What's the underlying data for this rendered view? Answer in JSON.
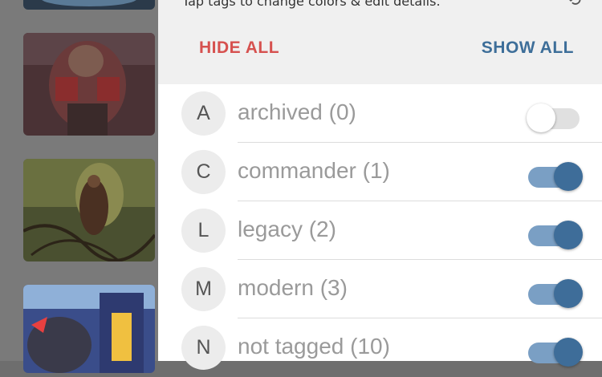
{
  "header": {
    "hint": "Tap tags to change colors & edit details.",
    "hide_all_label": "HIDE ALL",
    "show_all_label": "SHOW ALL"
  },
  "tags": [
    {
      "letter": "A",
      "label": "archived (0)",
      "enabled": false
    },
    {
      "letter": "C",
      "label": "commander (1)",
      "enabled": true
    },
    {
      "letter": "L",
      "label": "legacy (2)",
      "enabled": true
    },
    {
      "letter": "M",
      "label": "modern (3)",
      "enabled": true
    },
    {
      "letter": "N",
      "label": "not tagged (10)",
      "enabled": true
    }
  ],
  "colors": {
    "hide_all": "#d6514f",
    "show_all": "#3d6e99",
    "toggle_on_thumb": "#3e6d99",
    "toggle_on_track": "#7a9fc4",
    "toggle_off_track": "#e0e0e0"
  }
}
